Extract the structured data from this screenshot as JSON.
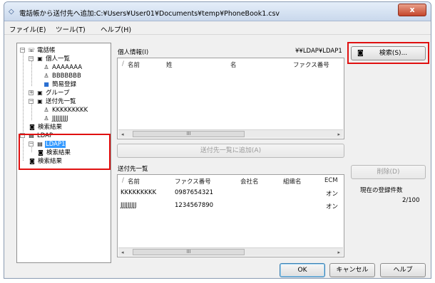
{
  "window": {
    "title": "電話帳から送付先へ追加:C:¥Users¥User01¥Documents¥temp¥PhoneBook1.csv",
    "close_label": "x"
  },
  "menu": [
    "ファイル(E)",
    "ツール(T)",
    "ヘルプ(H)"
  ],
  "tree": {
    "root": "電話帳",
    "personal": "個人一覧",
    "entries": [
      "AAAAAAA",
      "BBBBBBB"
    ],
    "simple": "簡易登録",
    "group": "グループ",
    "destinations": "送付先一覧",
    "dest_entries": [
      "KKKKKKKKK",
      "JJJJJJJJJ"
    ],
    "search_result": "検索結果",
    "ldap": "LDAP",
    "ldap1": "LDAP1",
    "ldap1_search": "検索結果",
    "ldap_search": "検索結果"
  },
  "personal_info": {
    "label": "個人情報(I)",
    "path": "¥¥LDAP¥LDAP1",
    "columns": [
      "名前",
      "姓",
      "名",
      "ファクス番号"
    ]
  },
  "search_button": "検索(S)...",
  "add_button": "送付先一覧に追加(A)",
  "destinations": {
    "label": "送付先一覧",
    "columns": [
      "名前",
      "ファクス番号",
      "会社名",
      "組織名",
      "ECM"
    ],
    "rows": [
      {
        "name": "KKKKKKKKK",
        "fax": "0987654321",
        "ecm": "オン"
      },
      {
        "name": "JJJJJJJJJ",
        "fax": "1234567890",
        "ecm": "オン"
      }
    ]
  },
  "delete_button": "削除(D)",
  "count": {
    "label": "現在の登録件数",
    "value": "2/100"
  },
  "footer": {
    "ok": "OK",
    "cancel": "キャンセル",
    "help": "ヘルプ"
  },
  "scroll_thumb": "III",
  "colors": {
    "highlight": "#e01010",
    "selection": "#3399ff"
  }
}
